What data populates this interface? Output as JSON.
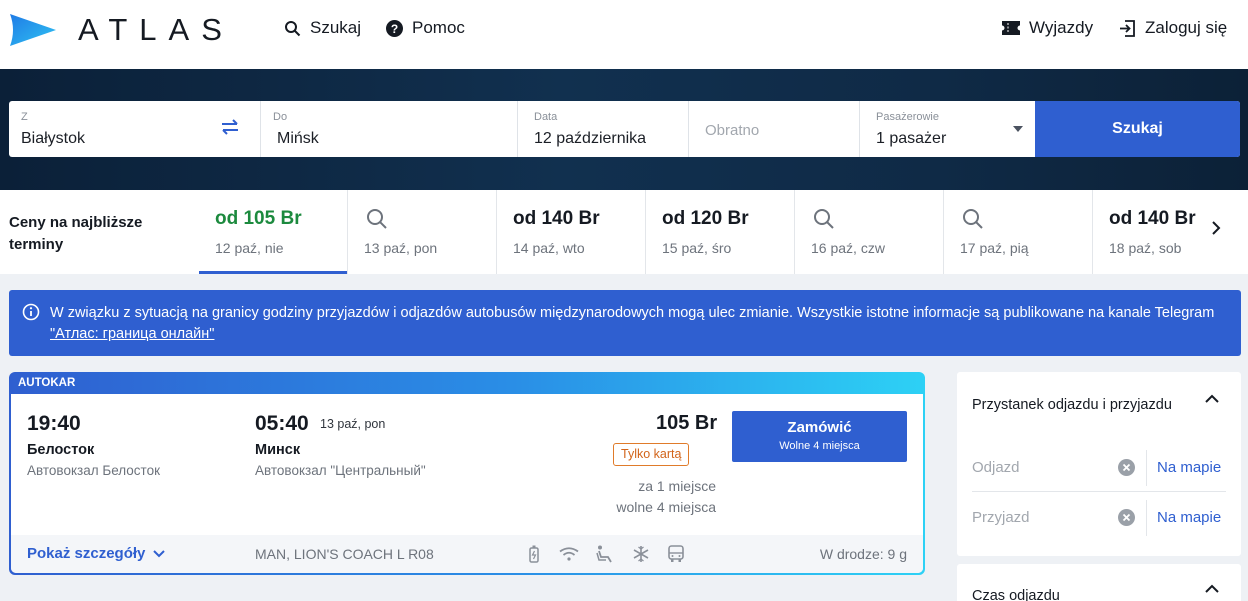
{
  "header": {
    "brand": "ATLAS",
    "nav_search": "Szukaj",
    "nav_help": "Pomoc",
    "nav_trips": "Wyjazdy",
    "nav_login": "Zaloguj się"
  },
  "search": {
    "from_label": "Z",
    "from_value": "Białystok",
    "to_label": "Do",
    "to_value": "Mińsk",
    "date_label": "Data",
    "date_value": "12 października",
    "return_placeholder": "Obratno",
    "passengers_label": "Pasażerowie",
    "passengers_value": "1 pasażer",
    "button": "Szukaj"
  },
  "prices": {
    "label": "Ceny na najbliższe terminy",
    "days": [
      {
        "price": "od 105 Br",
        "date": "12 paź, nie",
        "active": true
      },
      {
        "price": "",
        "date": "13 paź, pon",
        "active": false
      },
      {
        "price": "od 140 Br",
        "date": "14 paź, wto",
        "active": false
      },
      {
        "price": "od 120 Br",
        "date": "15 paź, śro",
        "active": false
      },
      {
        "price": "",
        "date": "16 paź, czw",
        "active": false
      },
      {
        "price": "",
        "date": "17 paź, pią",
        "active": false
      },
      {
        "price": "od 140 Br",
        "date": "18 paź, sob",
        "active": false
      }
    ]
  },
  "notice": {
    "text": "W związku z sytuacją na granicy godziny przyjazdów i odjazdów autobusów międzynarodowych mogą ulec zmianie. Wszystkie istotne informacje są publikowane na kanale Telegram ",
    "link": "\"Атлас: граница онлайн\""
  },
  "trip": {
    "type": "AUTOKAR",
    "depart_time": "19:40",
    "depart_city": "Белосток",
    "depart_stop": "Автовокзал Белосток",
    "arrive_time": "05:40",
    "arrive_date": "13 paź, pon",
    "arrive_city": "Минск",
    "arrive_stop": "Автовокзал \"Центральный\"",
    "price": "105 Br",
    "badge": "Tylko kartą",
    "per_seat": "za 1 miejsce",
    "free_seats": "wolne 4 miejsca",
    "order_label": "Zamówić",
    "order_sub": "Wolne 4 miejsca",
    "details": "Pokaż szczegóły",
    "bus": "MAN, LION'S COACH L R08",
    "duration": "W drodze: 9 g"
  },
  "filters": {
    "stops_title": "Przystanek odjazdu i przyjazdu",
    "depart_placeholder": "Odjazd",
    "arrive_placeholder": "Przyjazd",
    "map_link": "Na mapie",
    "time_title": "Czas odjazdu"
  },
  "colors": {
    "primary": "#2f5fd0",
    "green_price": "#1c8a3e",
    "badge_orange": "#d2641a",
    "hero_dark": "#0f2a46"
  }
}
